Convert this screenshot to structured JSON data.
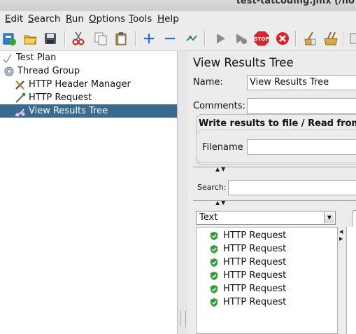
{
  "window": {
    "title": "test-tatcoding.jmx (/ho"
  },
  "menu": [
    "Edit",
    "Search",
    "Run",
    "Options",
    "Tools",
    "Help"
  ],
  "menu_mnemonics": [
    "E",
    "S",
    "R",
    "O",
    "T",
    "H"
  ],
  "menu_rest": [
    "dit",
    "earch",
    "un",
    "ptions",
    "ools",
    "elp"
  ],
  "toolbar_icons": [
    "templates-icon",
    "open-icon",
    "save-icon",
    "cut-icon",
    "copy-icon",
    "paste-icon",
    "expand-icon",
    "collapse-icon",
    "toggle-icon",
    "start-icon",
    "start-no-pause-icon",
    "stop-icon",
    "shutdown-icon",
    "clear-icon",
    "clear-all-icon"
  ],
  "tree": {
    "items": [
      {
        "label": "Test Plan",
        "icon": "test-plan-icon"
      },
      {
        "label": "Thread Group",
        "icon": "thread-group-icon"
      },
      {
        "label": "HTTP Header Manager",
        "icon": "header-manager-icon"
      },
      {
        "label": "HTTP Request",
        "icon": "http-request-icon"
      },
      {
        "label": "View Results Tree",
        "icon": "results-tree-icon",
        "selected": true
      }
    ]
  },
  "panel": {
    "title": "View Results Tree",
    "name_label": "Name:",
    "name_value": "View Results Tree",
    "comments_label": "Comments:",
    "comments_value": "",
    "write_results_label": "Write results to file / Read from",
    "filename_label": "Filename",
    "filename_value": "",
    "search_label": "Search:",
    "search_value": "",
    "renderer_selected": "Text",
    "results": [
      "HTTP Request",
      "HTTP Request",
      "HTTP Request",
      "HTTP Request",
      "HTTP Request",
      "HTTP Request"
    ],
    "result_status": "success"
  },
  "colors": {
    "selection": "#3b6a8f",
    "success": "#2e9e2e",
    "stop": "#d9252a"
  }
}
